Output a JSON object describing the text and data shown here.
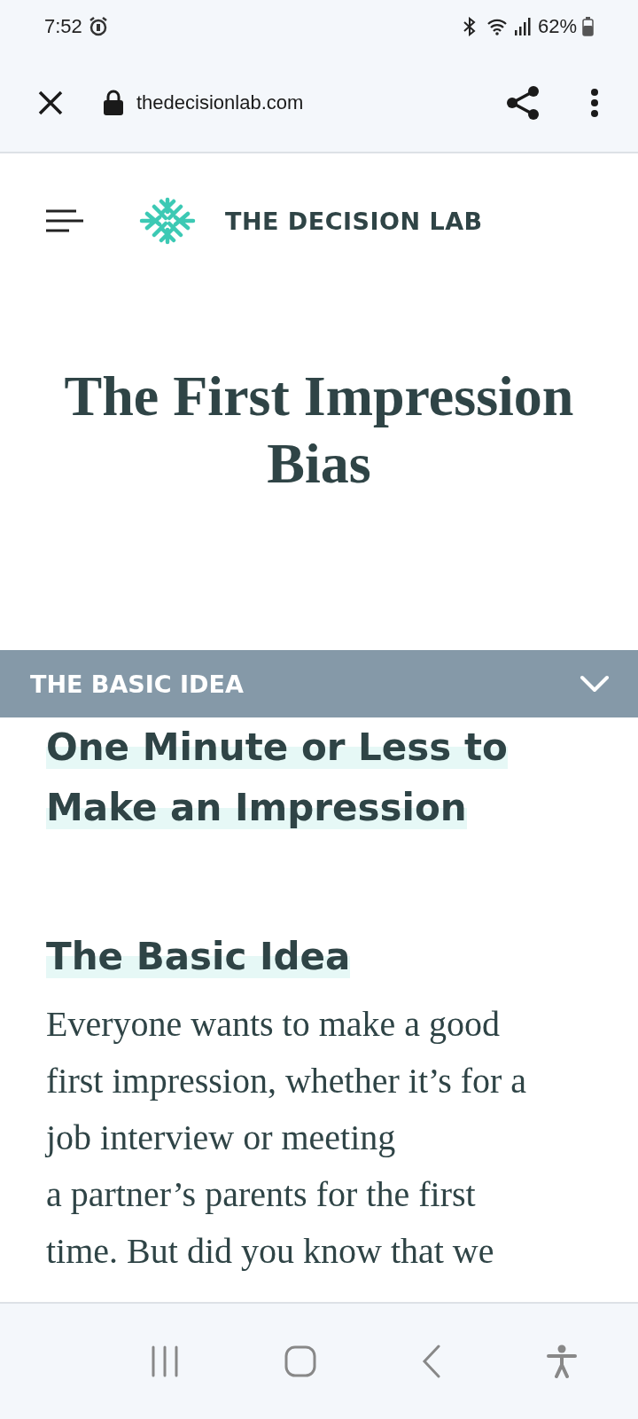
{
  "status_bar": {
    "time": "7:52",
    "battery": "62%"
  },
  "browser": {
    "url": "thedecisionlab.com"
  },
  "site": {
    "name": "THE DECISION LAB"
  },
  "article": {
    "title": "The First Impression Bias",
    "section_bar": {
      "label": "THE BASIC IDEA",
      "expanded": false
    },
    "subtitle": "One Minute or Less to Make an Impression",
    "heading": "The Basic Idea",
    "paragraph_lines": [
      "Everyone wants to make a good",
      "first impression, whether it’s for a",
      "job interview or meeting",
      "a partner’s parents for the first",
      "time. But did you know that we"
    ]
  }
}
